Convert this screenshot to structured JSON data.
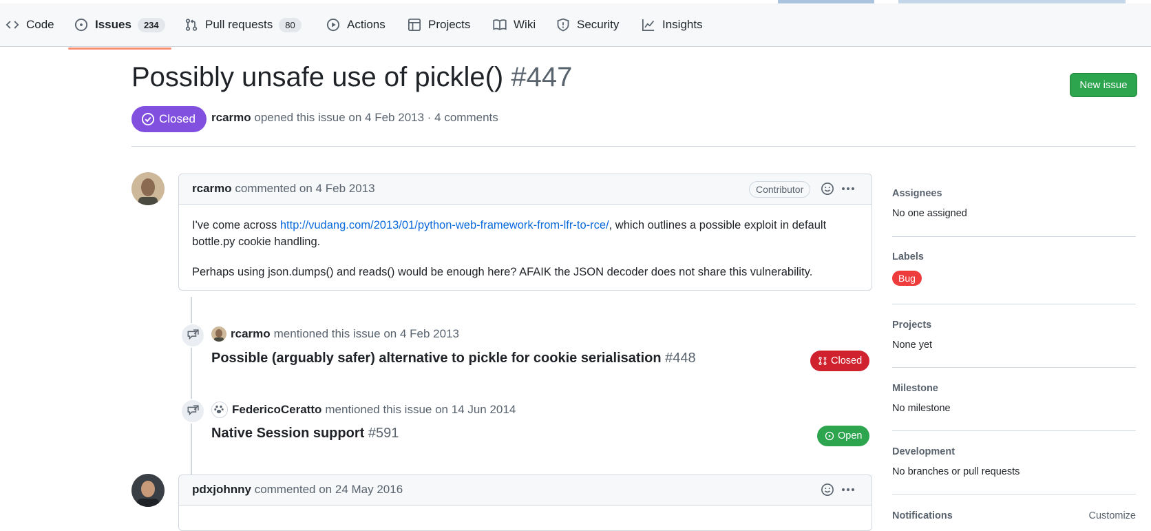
{
  "nav": {
    "tabs": [
      {
        "label": "Code",
        "icon": "code-icon"
      },
      {
        "label": "Issues",
        "count": "234",
        "icon": "issue-opened-icon",
        "active": true
      },
      {
        "label": "Pull requests",
        "count": "80",
        "icon": "git-pull-request-icon"
      },
      {
        "label": "Actions",
        "icon": "play-icon"
      },
      {
        "label": "Projects",
        "icon": "table-icon"
      },
      {
        "label": "Wiki",
        "icon": "book-icon"
      },
      {
        "label": "Security",
        "icon": "shield-icon"
      },
      {
        "label": "Insights",
        "icon": "graph-icon"
      }
    ]
  },
  "issue": {
    "title": "Possibly unsafe use of pickle()",
    "number": "#447",
    "state": "Closed",
    "author": "rcarmo",
    "meta_text": "opened this issue on 4 Feb 2013 · 4 comments",
    "new_issue_label": "New issue"
  },
  "comments": [
    {
      "author": "rcarmo",
      "action": "commented on 4 Feb 2013",
      "badge": "Contributor",
      "body": {
        "p1_before": "I've come across ",
        "p1_link": "http://vudang.com/2013/01/python-web-framework-from-lfr-to-rce/",
        "p1_after": ", which outlines a possible exploit in default bottle.py cookie handling.",
        "p2": "Perhaps using json.dumps() and reads() would be enough here? AFAIK the JSON decoder does not share this vulnerability."
      }
    },
    {
      "author": "pdxjohnny",
      "action": "commented on 24 May 2016"
    }
  ],
  "events": [
    {
      "actor": "rcarmo",
      "text": "mentioned this issue on 4 Feb 2013",
      "ref_title": "Possible (arguably safer) alternative to pickle for cookie serialisation",
      "ref_number": "#448",
      "ref_state": "Closed",
      "ref_state_color": "#cf222e"
    },
    {
      "actor": "FedericoCeratto",
      "text": "mentioned this issue on 14 Jun 2014",
      "ref_title": "Native Session support",
      "ref_number": "#591",
      "ref_state": "Open",
      "ref_state_color": "#2da44e"
    }
  ],
  "sidebar": {
    "assignees": {
      "heading": "Assignees",
      "value": "No one assigned"
    },
    "labels": {
      "heading": "Labels",
      "value": "Bug",
      "color": "#ee3b3b"
    },
    "projects": {
      "heading": "Projects",
      "value": "None yet"
    },
    "milestone": {
      "heading": "Milestone",
      "value": "No milestone"
    },
    "development": {
      "heading": "Development",
      "value": "No branches or pull requests"
    },
    "notifications": {
      "heading": "Notifications",
      "action": "Customize"
    }
  },
  "colors": {
    "closed_purple": "#8250df",
    "primary_green": "#2da44e",
    "link_blue": "#0969da",
    "tab_underline": "#fd8c73"
  }
}
